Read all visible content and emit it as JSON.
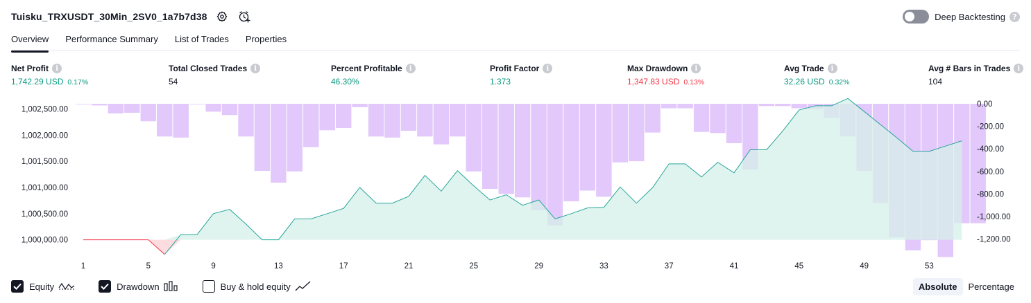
{
  "header": {
    "title": "Tuisku_TRXUSDT_30Min_2SV0_1a7b7d38",
    "deep_backtesting_label": "Deep Backtesting",
    "help_glyph": "?"
  },
  "tabs": [
    {
      "label": "Overview",
      "active": true
    },
    {
      "label": "Performance Summary",
      "active": false
    },
    {
      "label": "List of Trades",
      "active": false
    },
    {
      "label": "Properties",
      "active": false
    }
  ],
  "metrics": [
    {
      "label": "Net Profit",
      "value": "1,742.29 USD",
      "pct": "0.17%",
      "color": "green"
    },
    {
      "label": "Total Closed Trades",
      "value": "54",
      "pct": "",
      "color": "dark"
    },
    {
      "label": "Percent Profitable",
      "value": "46.30%",
      "pct": "",
      "color": "green"
    },
    {
      "label": "Profit Factor",
      "value": "1.373",
      "pct": "",
      "color": "green"
    },
    {
      "label": "Max Drawdown",
      "value": "1,347.83 USD",
      "pct": "0.13%",
      "color": "red"
    },
    {
      "label": "Avg Trade",
      "value": "32.26 USD",
      "pct": "0.32%",
      "color": "green"
    },
    {
      "label": "Avg # Bars in Trades",
      "value": "104",
      "pct": "",
      "color": "dark"
    }
  ],
  "colors": {
    "equity_line": "#26a69a",
    "equity_fill": "#d6f0ea",
    "equity_negative": "#f23645",
    "drawdown_bar": "#dfc2fb",
    "text": "#131722"
  },
  "chart_data": {
    "type": "area",
    "x_ticks": [
      "1",
      "5",
      "9",
      "13",
      "17",
      "21",
      "25",
      "29",
      "33",
      "37",
      "41",
      "45",
      "49",
      "53"
    ],
    "left_axis_ticks": [
      "1,002,500.00",
      "1,002,000.00",
      "1,001,500.00",
      "1,001,000.00",
      "1,000,500.00",
      "1,000,000.00"
    ],
    "right_axis_ticks": [
      "0.00",
      "-200.00",
      "-400.00",
      "-600.00",
      "-800.00",
      "-1,000.00",
      "-1,200.00"
    ],
    "left_ylim": [
      999850,
      1002730
    ],
    "right_ylim": [
      -1350,
      0
    ],
    "series": [
      {
        "name": "Equity",
        "x": [
          1,
          2,
          3,
          4,
          5,
          6,
          7,
          8,
          9,
          10,
          11,
          12,
          13,
          14,
          15,
          16,
          17,
          18,
          19,
          20,
          21,
          22,
          23,
          24,
          25,
          26,
          27,
          28,
          29,
          30,
          31,
          32,
          33,
          34,
          35,
          36,
          37,
          38,
          39,
          40,
          41,
          42,
          43,
          44,
          45,
          46,
          47,
          48,
          49,
          50,
          51,
          52,
          53,
          54,
          55
        ],
        "values": [
          1000000,
          1000000,
          1000000,
          1000000,
          1000000,
          999720,
          1000100,
          1000100,
          1000500,
          1000580,
          1000300,
          1000000,
          1000000,
          1000400,
          1000400,
          1000500,
          1000600,
          1001000,
          1000700,
          1000700,
          1000830,
          1001230,
          1000930,
          1001320,
          1001030,
          1000760,
          1000860,
          1000660,
          1000760,
          1000400,
          1000500,
          1000610,
          1000620,
          1001010,
          1000700,
          1001000,
          1001450,
          1001450,
          1001200,
          1001480,
          1001280,
          1001720,
          1001720,
          1002080,
          1002480,
          1002560,
          1002560,
          1002700,
          1002450,
          1002200,
          1001950,
          1001690,
          1001690,
          1001790,
          1001890
        ]
      },
      {
        "name": "Drawdown",
        "x": [
          1,
          2,
          3,
          4,
          5,
          6,
          7,
          8,
          9,
          10,
          11,
          12,
          13,
          14,
          15,
          16,
          17,
          18,
          19,
          20,
          21,
          22,
          23,
          24,
          25,
          26,
          27,
          28,
          29,
          30,
          31,
          32,
          33,
          34,
          35,
          36,
          37,
          38,
          39,
          40,
          41,
          42,
          43,
          44,
          45,
          46,
          47,
          48,
          49,
          50,
          51,
          52,
          53,
          54,
          55,
          56
        ],
        "values": [
          0,
          -15,
          -85,
          -80,
          -155,
          -290,
          -300,
          0,
          -70,
          -100,
          -290,
          -595,
          -700,
          -600,
          -385,
          -235,
          -215,
          -30,
          -290,
          -300,
          -240,
          -290,
          -360,
          -290,
          -600,
          -755,
          -800,
          -830,
          -945,
          -1080,
          -865,
          -770,
          -825,
          -520,
          -510,
          -255,
          -40,
          -40,
          -250,
          -260,
          -350,
          -585,
          -20,
          -20,
          -40,
          -50,
          -125,
          -290,
          -595,
          -880,
          -1185,
          -1300,
          -1210,
          -1360,
          -1060,
          -1060
        ]
      }
    ],
    "legend": [
      "Equity",
      "Drawdown",
      "Buy & hold equity"
    ],
    "grid": false
  },
  "footer": {
    "equity_label": "Equity",
    "drawdown_label": "Drawdown",
    "buyhold_label": "Buy & hold equity",
    "absolute_label": "Absolute",
    "percentage_label": "Percentage"
  }
}
